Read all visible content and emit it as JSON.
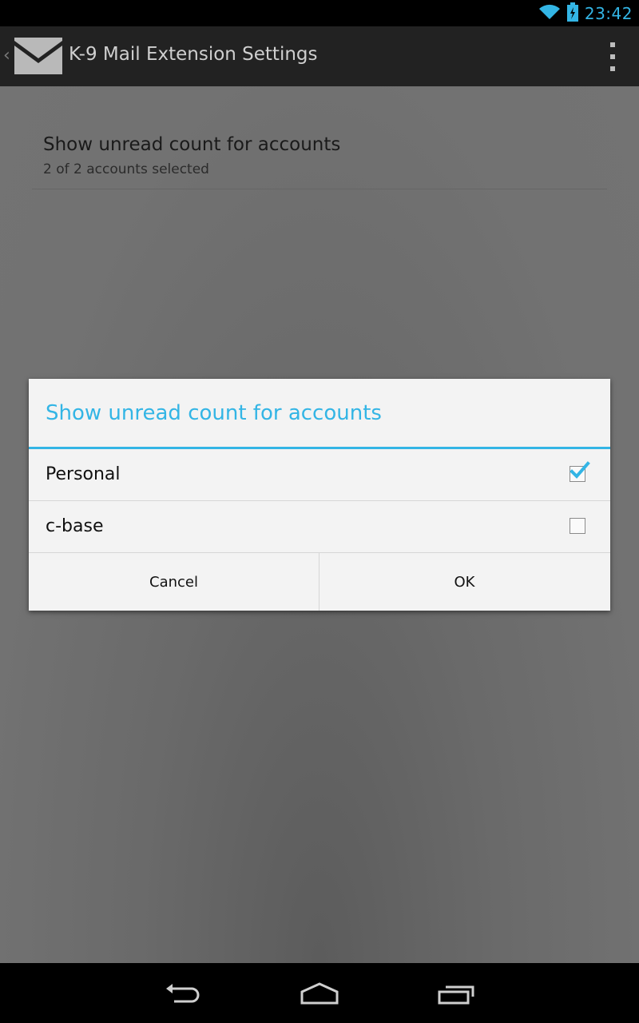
{
  "status_bar": {
    "time": "23:42",
    "icons": [
      "wifi-icon",
      "battery-charging-icon"
    ]
  },
  "action_bar": {
    "title": "K-9 Mail Extension Settings",
    "app_icon": "envelope-icon",
    "overflow_icon": "overflow-menu-icon"
  },
  "preference": {
    "title": "Show unread count for accounts",
    "summary": "2 of 2 accounts selected"
  },
  "dialog": {
    "title": "Show unread count for accounts",
    "options": [
      {
        "label": "Personal",
        "checked": true
      },
      {
        "label": "c-base",
        "checked": false
      }
    ],
    "cancel_label": "Cancel",
    "ok_label": "OK"
  },
  "nav_bar": {
    "icons": [
      "back-icon",
      "home-icon",
      "recent-apps-icon"
    ]
  },
  "colors": {
    "accent": "#33b5e5",
    "action_bar": "#222222",
    "dialog_bg": "#f3f3f3"
  }
}
